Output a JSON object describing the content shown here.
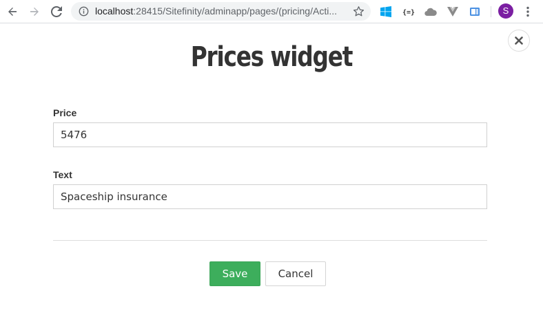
{
  "browser": {
    "url_host": "localhost",
    "url_path": ":28415/Sitefinity/adminapp/pages/(pricing/Acti...",
    "profile_initial": "S",
    "icons": {
      "back": "arrow-left-icon",
      "forward": "arrow-right-icon",
      "reload": "reload-icon",
      "info": "info-icon",
      "bookmark": "star-icon",
      "menu": "vertical-dots-icon"
    },
    "extensions": [
      "windows-icon",
      "json-braces-icon",
      "cloud-icon",
      "vue-icon",
      "devtools-icon"
    ],
    "colors": {
      "avatar": "#7b1fa2",
      "omnibox": "#f1f3f4"
    }
  },
  "dialog": {
    "title": "Prices widget",
    "close_icon": "close-icon",
    "fields": {
      "price": {
        "label": "Price",
        "value": "5476"
      },
      "text": {
        "label": "Text",
        "value": "Spaceship insurance"
      }
    },
    "buttons": {
      "save": "Save",
      "cancel": "Cancel"
    },
    "colors": {
      "save": "#3dae5c",
      "title": "#333333"
    }
  }
}
